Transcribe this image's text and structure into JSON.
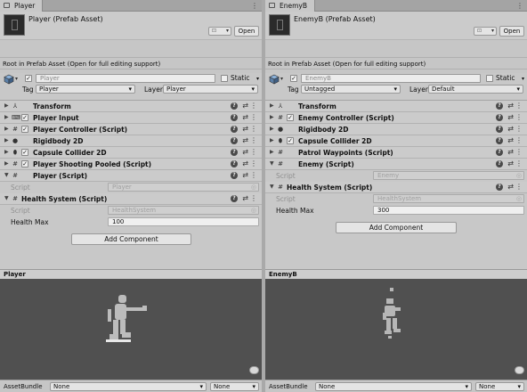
{
  "panels": [
    {
      "tab": "Player",
      "asset_title": "Player (Prefab Asset)",
      "header_select": "⊡",
      "open_label": "Open",
      "notice": "Root in Prefab Asset (Open for full editing support)",
      "name_value": "Player",
      "static_label": "Static",
      "tag_label": "Tag",
      "tag_value": "Player",
      "layer_label": "Layer",
      "layer_value": "Player",
      "components": [
        {
          "name": "Transform",
          "icon": "transform-icon",
          "check": false
        },
        {
          "name": "Player Input",
          "icon": "input-icon",
          "check": true
        },
        {
          "name": "Player Controller (Script)",
          "icon": "script-icon",
          "check": true
        },
        {
          "name": "Rigidbody 2D",
          "icon": "rigidbody-icon",
          "check": false
        },
        {
          "name": "Capsule Collider 2D",
          "icon": "capsule-icon",
          "check": true
        },
        {
          "name": "Player Shooting Pooled (Script)",
          "icon": "script-icon",
          "check": true
        },
        {
          "name": "Player (Script)",
          "icon": "script-icon",
          "check": false,
          "expanded": true
        }
      ],
      "player_script": {
        "label": "Script",
        "value": "Player"
      },
      "health": {
        "name": "Health System (Script)",
        "script_label": "Script",
        "script_value": "HealthSystem",
        "max_label": "Health Max",
        "max_value": "100"
      },
      "add_component": "Add Component",
      "preview_title": "Player",
      "bundle_label": "AssetBundle",
      "bundle_value": "None",
      "bundle_variant": "None"
    },
    {
      "tab": "EnemyB",
      "asset_title": "EnemyB (Prefab Asset)",
      "header_select": "⊡",
      "open_label": "Open",
      "notice": "Root in Prefab Asset (Open for full editing support)",
      "name_value": "EnemyB",
      "static_label": "Static",
      "tag_label": "Tag",
      "tag_value": "Untagged",
      "layer_label": "Layer",
      "layer_value": "Default",
      "components": [
        {
          "name": "Transform",
          "icon": "transform-icon",
          "check": false
        },
        {
          "name": "Enemy Controller (Script)",
          "icon": "script-icon",
          "check": true
        },
        {
          "name": "Rigidbody 2D",
          "icon": "rigidbody-icon",
          "check": false
        },
        {
          "name": "Capsule Collider 2D",
          "icon": "capsule-icon",
          "check": true
        },
        {
          "name": "Patrol Waypoints (Script)",
          "icon": "script-icon",
          "check": false
        },
        {
          "name": "Enemy (Script)",
          "icon": "script-icon",
          "check": false,
          "expanded": true
        }
      ],
      "player_script": {
        "label": "Script",
        "value": "Enemy"
      },
      "health": {
        "name": "Health System (Script)",
        "script_label": "Script",
        "script_value": "HealthSystem",
        "max_label": "Health Max",
        "max_value": "300"
      },
      "add_component": "Add Component",
      "preview_title": "EnemyB",
      "bundle_label": "AssetBundle",
      "bundle_value": "None",
      "bundle_variant": "None"
    }
  ],
  "icons": {
    "help": "?",
    "settings": "⇄",
    "kebab": "⋮",
    "fold_closed": "▶",
    "fold_open": "▼",
    "check": "✓"
  }
}
